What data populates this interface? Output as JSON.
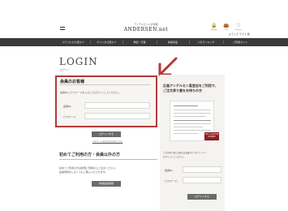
{
  "header": {
    "logo_sub": "アンデルセン公式通販",
    "logo": "ANDERSEN.net",
    "icons": [
      {
        "name": "lock-icon",
        "glyph": "🔒",
        "label": "Mypage"
      },
      {
        "name": "cart-icon",
        "glyph": "👜",
        "label": "Cart"
      },
      {
        "name": "heart-icon",
        "glyph": "♡",
        "label": "Favorite"
      }
    ],
    "user_line": "ようこそ ゲスト 様"
  },
  "nav": {
    "items": [
      "カテゴリから選ぶ ▾",
      "ギフトから選ぶ ▾",
      "季節・行事",
      "新着商品",
      "人気ランキング",
      "ご利用ガイド"
    ]
  },
  "login": {
    "title": "LOGIN",
    "subtitle": "ログイン"
  },
  "member": {
    "title": "会員のお客様",
    "desc": "会員IDとパスワードを入力してログインしてください。",
    "id_label": "会員ID：",
    "password_label": "パスワード：",
    "login_button": "ログインする",
    "forgot_link": "パスワードをお忘れの方はこちら"
  },
  "first_time": {
    "title": "初めてご利用の方・会員以外の方",
    "desc_lines": [
      "初めてご利用の方は新規ご登録の上ご注文ください。",
      "会員登録をしなくてもご購入いただけます。"
    ],
    "register_button": "新規会員登録"
  },
  "right": {
    "title_lines": [
      "広島アンデルセン直営店をご利用で、",
      "ご注文承り書をお持ちの方"
    ],
    "badge": "弊社ご注文承り書の会員番号",
    "desc_lines": [
      "ご注文承り書に記載の会員番号とパスワードで",
      "ログインしてください。"
    ],
    "id_label": "会員ID：",
    "password_label": "パスワード：",
    "login_button": "ログインする"
  },
  "colors": {
    "highlight_border": "#b23a3a",
    "nav_bg": "#3a3a3a",
    "button_bg": "#6b6b6b",
    "badge_bg": "#8b1e1e"
  }
}
